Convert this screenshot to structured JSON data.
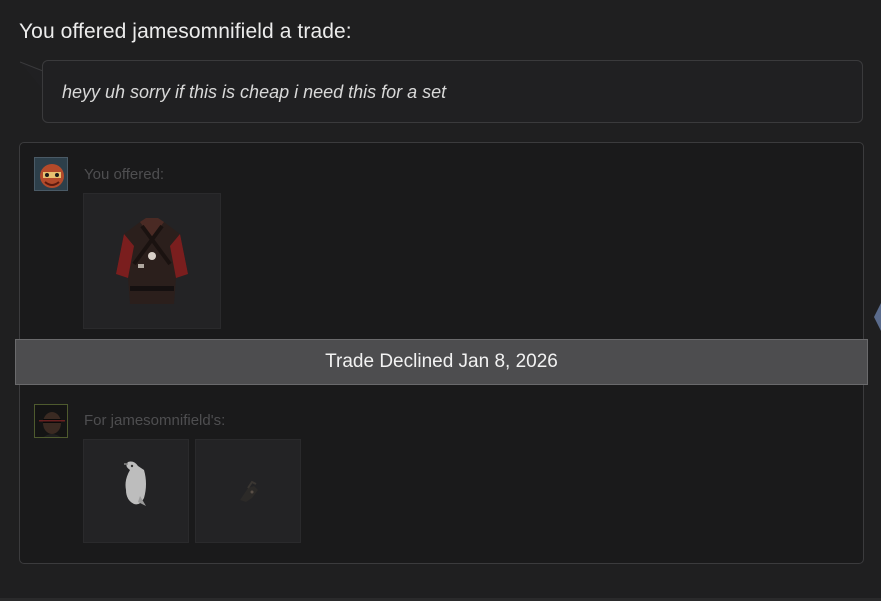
{
  "header": {
    "title": "You offered jamesomnifield a trade:"
  },
  "message": {
    "text": "heyy uh sorry if this is cheap i need this for a set"
  },
  "trade": {
    "you_offered_label": "You offered:",
    "for_them_label": "For jamesomnifield's:",
    "status": "Trade Declined Jan 8, 2026",
    "your_items": [
      {
        "icon": "red-coat-item-icon"
      }
    ],
    "their_items": [
      {
        "icon": "white-bird-item-icon"
      },
      {
        "icon": "small-dark-item-icon"
      }
    ]
  },
  "colors": {
    "background": "#1f1f20",
    "panel": "#1a1a1b",
    "status_bar": "#4d4d4f",
    "text_primary": "#ececec",
    "text_muted": "#4e4e50",
    "accent_tab": "#5a6b8c"
  }
}
